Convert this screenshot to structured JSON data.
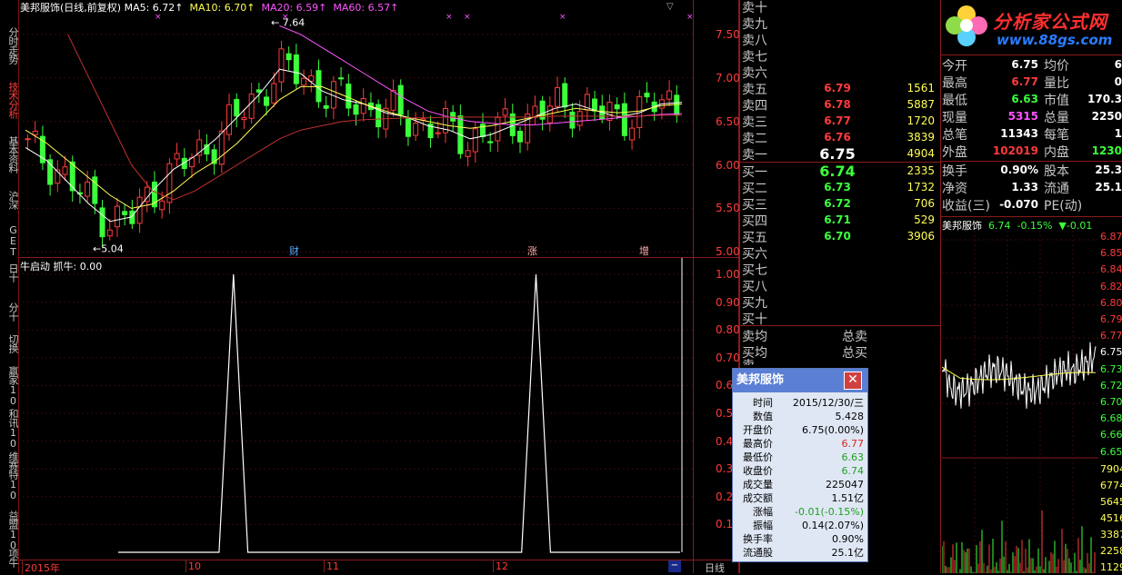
{
  "window": {
    "stock_title": "美邦服饰(日线,前复权)",
    "ma5": "MA5: 6.72↑",
    "ma10": "MA10: 6.70↑",
    "ma20": "MA20: 6.59↑",
    "ma60": "MA60: 6.57↑",
    "high_label": "7.64",
    "low_label": "5.04",
    "marker_cai": "财",
    "marker_zhang": "涨",
    "marker_zeng": "增",
    "indicator_title": "牛启动  抓牛: 0.00",
    "period_label": "日线",
    "colors": {
      "rise": "#ff3b3b",
      "fall": "#3cff3c",
      "ma5": "#ffffff",
      "ma10": "#ffff55",
      "ma20": "#ff55ff",
      "ma60": "#c03030",
      "panel_border": "#8a1a1a"
    }
  },
  "left_tabs": [
    {
      "label": "分时走势",
      "active": false
    },
    {
      "label": "技术分析",
      "active": true
    },
    {
      "label": "基本资料",
      "active": false
    },
    {
      "label": "沪深",
      "active": false
    },
    {
      "label": "GET",
      "active": false
    },
    {
      "label": "日十",
      "active": false
    },
    {
      "label": "分十",
      "active": false
    },
    {
      "label": "切换",
      "active": false
    },
    {
      "label": "赢家10",
      "active": false
    },
    {
      "label": "和讯10",
      "active": false
    },
    {
      "label": "维赛特10",
      "active": false
    },
    {
      "label": "益盟10",
      "active": false
    },
    {
      "label": "项牛",
      "active": false
    }
  ],
  "price_axis": [
    "7.50",
    "7.00",
    "6.50",
    "6.00",
    "5.50",
    "5.00"
  ],
  "indicator_axis": [
    "1.00",
    "0.90",
    "0.80",
    "0.70",
    "0.60",
    "0.50",
    "0.40",
    "0.30",
    "0.20",
    "0.10"
  ],
  "x_axis": [
    "2015年",
    "10",
    "11",
    "12"
  ],
  "chart_data": [
    {
      "type": "line",
      "title": "美邦服饰(日线,前复权)",
      "ylim": [
        5.0,
        7.64
      ],
      "series": [
        {
          "name": "MA5",
          "values": [
            6.2,
            6.05,
            5.8,
            5.55,
            5.35,
            5.4,
            5.7,
            5.95,
            6.1,
            6.3,
            6.55,
            6.8,
            7.1,
            7.05,
            6.85,
            6.75,
            6.7,
            6.6,
            6.55,
            6.45,
            6.4,
            6.3,
            6.35,
            6.45,
            6.55,
            6.65,
            6.7,
            6.62,
            6.55,
            6.6,
            6.7,
            6.72
          ]
        },
        {
          "name": "MA10",
          "values": [
            6.4,
            6.25,
            6.05,
            5.85,
            5.65,
            5.5,
            5.55,
            5.7,
            5.9,
            6.05,
            6.25,
            6.5,
            6.75,
            6.9,
            6.9,
            6.8,
            6.7,
            6.62,
            6.55,
            6.5,
            6.45,
            6.42,
            6.45,
            6.5,
            6.55,
            6.6,
            6.65,
            6.62,
            6.6,
            6.62,
            6.68,
            6.7
          ]
        },
        {
          "name": "MA20",
          "values": [
            null,
            null,
            null,
            null,
            null,
            null,
            null,
            null,
            null,
            null,
            null,
            null,
            7.6,
            7.5,
            7.35,
            7.2,
            7.05,
            6.9,
            6.75,
            6.62,
            6.55,
            6.5,
            6.48,
            6.46,
            6.46,
            6.48,
            6.5,
            6.52,
            6.54,
            6.56,
            6.58,
            6.59
          ]
        },
        {
          "name": "MA60",
          "values": [
            null,
            null,
            7.5,
            7.0,
            6.5,
            6.0,
            5.7,
            5.6,
            5.7,
            5.85,
            6.0,
            6.15,
            6.3,
            6.4,
            6.45,
            6.5,
            6.52,
            6.53,
            6.54,
            6.54,
            6.55,
            6.55,
            6.55,
            6.55,
            6.55,
            6.56,
            6.56,
            6.56,
            6.56,
            6.56,
            6.57,
            6.57
          ]
        }
      ]
    },
    {
      "type": "line",
      "title": "牛启动  抓牛: 0.00",
      "ylim": [
        0,
        1.0
      ],
      "series": [
        {
          "name": "抓牛",
          "values": [
            0,
            0,
            0,
            0,
            0,
            0,
            0,
            0,
            1,
            0,
            0,
            0,
            0,
            0,
            0,
            0,
            0,
            0,
            0,
            0,
            0,
            0,
            0,
            0,
            0,
            0,
            0,
            0,
            0,
            1,
            0,
            0,
            0,
            0,
            0,
            0,
            0,
            0,
            0,
            0
          ]
        }
      ]
    }
  ],
  "order_book": {
    "sell": [
      {
        "label": "卖十",
        "price": "",
        "volume": ""
      },
      {
        "label": "卖九",
        "price": "",
        "volume": ""
      },
      {
        "label": "卖八",
        "price": "",
        "volume": ""
      },
      {
        "label": "卖七",
        "price": "",
        "volume": ""
      },
      {
        "label": "卖六",
        "price": "",
        "volume": ""
      },
      {
        "label": "卖五",
        "price": "6.79",
        "volume": "1561"
      },
      {
        "label": "卖四",
        "price": "6.78",
        "volume": "5887"
      },
      {
        "label": "卖三",
        "price": "6.77",
        "volume": "1720"
      },
      {
        "label": "卖二",
        "price": "6.76",
        "volume": "3839"
      },
      {
        "label": "卖一",
        "price": "6.75",
        "volume": "4904"
      }
    ],
    "buy": [
      {
        "label": "买一",
        "price": "6.74",
        "volume": "2335"
      },
      {
        "label": "买二",
        "price": "6.73",
        "volume": "1732"
      },
      {
        "label": "买三",
        "price": "6.72",
        "volume": "706"
      },
      {
        "label": "买四",
        "price": "6.71",
        "volume": "529"
      },
      {
        "label": "买五",
        "price": "6.70",
        "volume": "3906"
      },
      {
        "label": "买六",
        "price": "",
        "volume": ""
      },
      {
        "label": "买七",
        "price": "",
        "volume": ""
      },
      {
        "label": "买八",
        "price": "",
        "volume": ""
      },
      {
        "label": "买九",
        "price": "",
        "volume": ""
      },
      {
        "label": "买十",
        "price": "",
        "volume": ""
      }
    ],
    "avg_sell": "卖均",
    "total_sell": "总卖",
    "avg_buy": "买均",
    "total_buy": "总买",
    "cut_label": "卖一"
  },
  "logo": {
    "text": "分析家公式网",
    "url": "www.88gs.com"
  },
  "quote": [
    {
      "k": "今开",
      "v": "6.75",
      "k2": "均价",
      "v2": "6"
    },
    {
      "k": "最高",
      "v": "6.77",
      "k2": "量比",
      "v2": "0"
    },
    {
      "k": "最低",
      "v": "6.63",
      "k2": "市值",
      "v2": "170.3"
    },
    {
      "k": "现量",
      "v": "5315",
      "k2": "总量",
      "v2": "2250"
    },
    {
      "k": "总笔",
      "v": "11343",
      "k2": "每笔",
      "v2": "1"
    },
    {
      "k": "外盘",
      "v": "102019",
      "k2": "内盘",
      "v2": "1230"
    },
    {
      "k": "换手",
      "v": "0.90%",
      "k2": "股本",
      "v2": "25.3"
    },
    {
      "k": "净资",
      "v": "1.33",
      "k2": "流通",
      "v2": "25.1"
    },
    {
      "k": "收益(三)",
      "v": "-0.070",
      "k2": "PE(动)",
      "v2": ""
    }
  ],
  "mini": {
    "title": "美邦服饰",
    "price": "6.74",
    "pct": "-0.15%",
    "chg": "▼-0.01",
    "axis": [
      "6.87",
      "6.85",
      "6.84",
      "6.82",
      "6.80",
      "6.79",
      "6.77",
      "6.75",
      "6.73",
      "6.72",
      "6.70",
      "6.68",
      "6.66",
      "6.65"
    ],
    "vol_axis": [
      "7904",
      "6774",
      "5645",
      "4516",
      "3387",
      "2258",
      "1129"
    ]
  },
  "popup": {
    "title": "美邦服饰",
    "rows": [
      {
        "k": "时间",
        "v": "2015/12/30/三",
        "c": "#000"
      },
      {
        "k": "数值",
        "v": "5.428",
        "c": "#000"
      },
      {
        "k": "开盘价",
        "v": "6.75(0.00%)",
        "c": "#000"
      },
      {
        "k": "最高价",
        "v": "6.77",
        "c": "#e02020"
      },
      {
        "k": "最低价",
        "v": "6.63",
        "c": "#20a020"
      },
      {
        "k": "收盘价",
        "v": "6.74",
        "c": "#20a020"
      },
      {
        "k": "成交量",
        "v": "225047",
        "c": "#000"
      },
      {
        "k": "成交额",
        "v": "1.51亿",
        "c": "#000"
      },
      {
        "k": "涨幅",
        "v": "-0.01(-0.15%)",
        "c": "#20a020"
      },
      {
        "k": "振幅",
        "v": "0.14(2.07%)",
        "c": "#000"
      },
      {
        "k": "换手率",
        "v": "0.90%",
        "c": "#000"
      },
      {
        "k": "流通股",
        "v": "25.1亿",
        "c": "#000"
      }
    ]
  }
}
